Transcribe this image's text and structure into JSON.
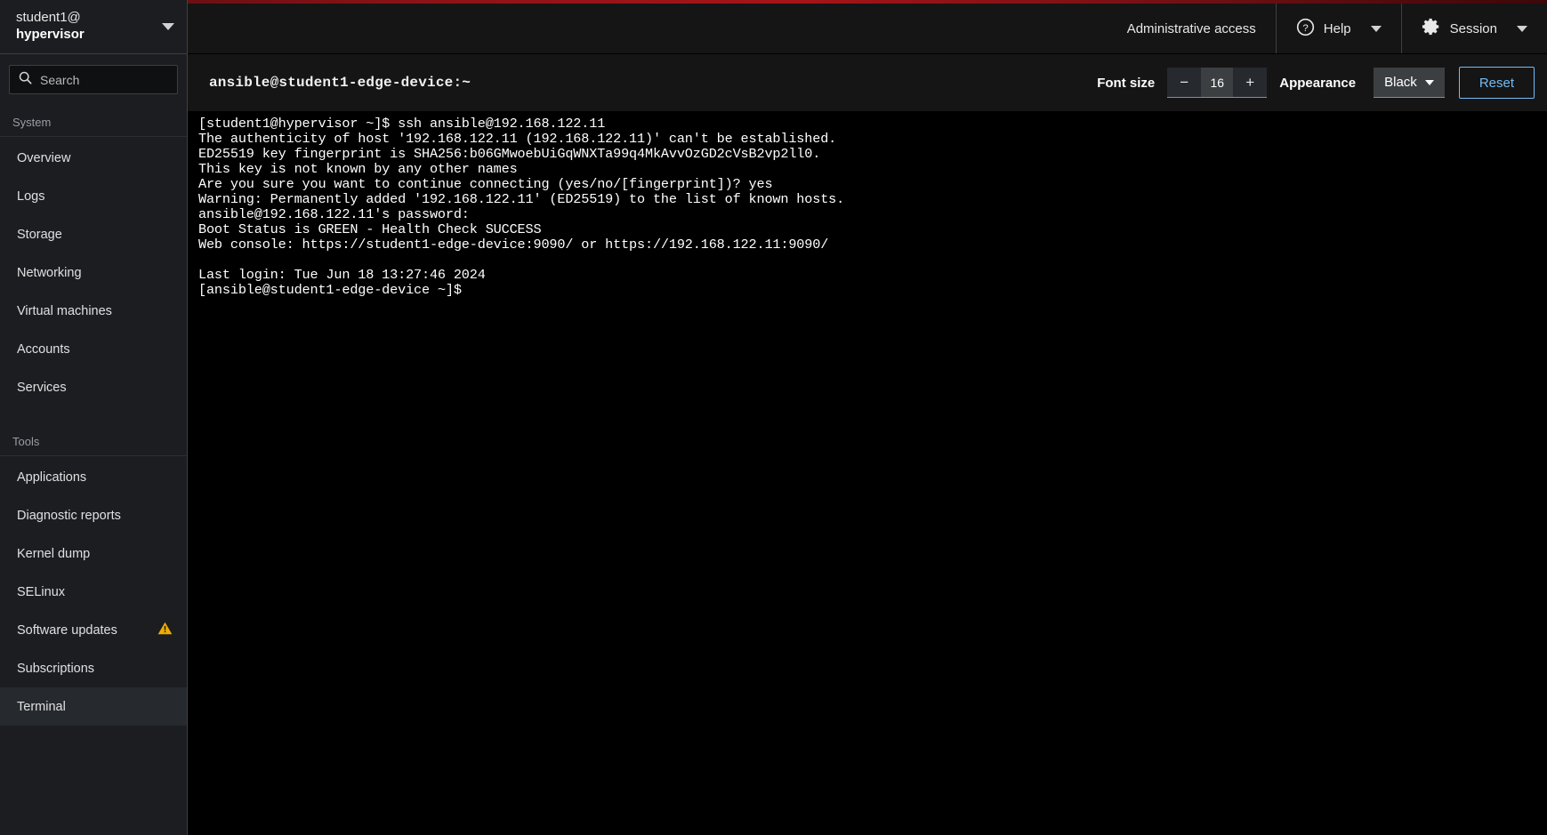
{
  "sidebar": {
    "host": {
      "user": "student1@",
      "name": "hypervisor",
      "caret_icon": "chevron-down-icon"
    },
    "search": {
      "placeholder": "Search",
      "value": "",
      "icon": "search-icon"
    },
    "groups": [
      {
        "heading": "System",
        "items": [
          {
            "label": "Overview",
            "selected": false,
            "badge": null
          },
          {
            "label": "Logs",
            "selected": false,
            "badge": null
          },
          {
            "label": "Storage",
            "selected": false,
            "badge": null
          },
          {
            "label": "Networking",
            "selected": false,
            "badge": null
          },
          {
            "label": "Virtual machines",
            "selected": false,
            "badge": null
          },
          {
            "label": "Accounts",
            "selected": false,
            "badge": null
          },
          {
            "label": "Services",
            "selected": false,
            "badge": null
          }
        ]
      },
      {
        "heading": "Tools",
        "items": [
          {
            "label": "Applications",
            "selected": false,
            "badge": null
          },
          {
            "label": "Diagnostic reports",
            "selected": false,
            "badge": null
          },
          {
            "label": "Kernel dump",
            "selected": false,
            "badge": null
          },
          {
            "label": "SELinux",
            "selected": false,
            "badge": null
          },
          {
            "label": "Software updates",
            "selected": false,
            "badge": "warning-triangle-icon"
          },
          {
            "label": "Subscriptions",
            "selected": false,
            "badge": null
          },
          {
            "label": "Terminal",
            "selected": true,
            "badge": null
          }
        ]
      }
    ]
  },
  "header": {
    "admin_access": "Administrative access",
    "help": {
      "label": "Help",
      "icon": "help-circle-icon",
      "caret_icon": "chevron-down-icon"
    },
    "session": {
      "label": "Session",
      "icon": "gear-icon",
      "caret_icon": "chevron-down-icon"
    },
    "accent_color": "#a51419"
  },
  "terminal_toolbar": {
    "title": "ansible@student1-edge-device:~",
    "font_size_label": "Font size",
    "decrease_label": "−",
    "font_size_value": "16",
    "increase_label": "+",
    "appearance_label": "Appearance",
    "theme_value": "Black",
    "theme_caret_icon": "chevron-down-icon",
    "reset_label": "Reset",
    "reset_color": "#73bcf7"
  },
  "terminal": {
    "lines": [
      "[student1@hypervisor ~]$ ssh ansible@192.168.122.11",
      "The authenticity of host '192.168.122.11 (192.168.122.11)' can't be established.",
      "ED25519 key fingerprint is SHA256:b06GMwoebUiGqWNXTa99q4MkAvvOzGD2cVsB2vp2ll0.",
      "This key is not known by any other names",
      "Are you sure you want to continue connecting (yes/no/[fingerprint])? yes",
      "Warning: Permanently added '192.168.122.11' (ED25519) to the list of known hosts.",
      "ansible@192.168.122.11's password:",
      "Boot Status is GREEN - Health Check SUCCESS",
      "Web console: https://student1-edge-device:9090/ or https://192.168.122.11:9090/",
      "",
      "Last login: Tue Jun 18 13:27:46 2024",
      "[ansible@student1-edge-device ~]$ "
    ],
    "background": "#000000",
    "foreground": "#ffffff"
  }
}
